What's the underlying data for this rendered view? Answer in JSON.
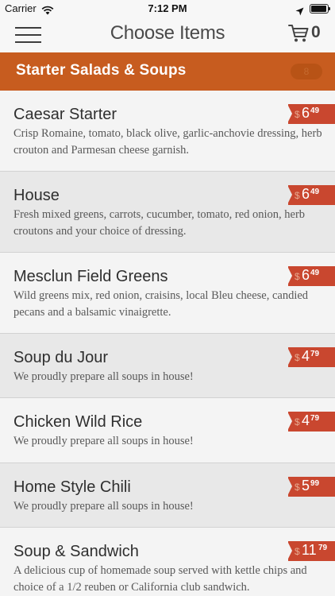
{
  "status_bar": {
    "carrier": "Carrier",
    "time": "7:12 PM",
    "battery_level": 0.95
  },
  "nav": {
    "title": "Choose Items",
    "cart_count": "0"
  },
  "category": {
    "name": "Starter Salads & Soups",
    "count": "8"
  },
  "items": [
    {
      "name": "Caesar Starter",
      "description": "Crisp Romaine, tomato, black olive, garlic-anchovie dressing, herb crouton and Parmesan cheese garnish.",
      "currency": "$",
      "price_dollars": "6",
      "price_cents": "49"
    },
    {
      "name": "House",
      "description": "Fresh mixed greens, carrots, cucumber, tomato, red onion, herb croutons and your choice of dressing.",
      "currency": "$",
      "price_dollars": "6",
      "price_cents": "49"
    },
    {
      "name": "Mesclun Field Greens",
      "description": "Wild greens mix, red onion, craisins, local Bleu cheese, candied pecans and a balsamic vinaigrette.",
      "currency": "$",
      "price_dollars": "6",
      "price_cents": "49"
    },
    {
      "name": "Soup du Jour",
      "description": "We proudly prepare all soups in house!",
      "currency": "$",
      "price_dollars": "4",
      "price_cents": "79"
    },
    {
      "name": "Chicken Wild Rice",
      "description": "We proudly prepare all soups in house!",
      "currency": "$",
      "price_dollars": "4",
      "price_cents": "79"
    },
    {
      "name": "Home Style Chili",
      "description": "We proudly prepare all soups in house!",
      "currency": "$",
      "price_dollars": "5",
      "price_cents": "99"
    },
    {
      "name": "Soup & Sandwich",
      "description": "A delicious cup of homemade soup served with kettle chips and choice of a 1/2 reuben or California club sandwich.",
      "currency": "$",
      "price_dollars": "11",
      "price_cents": "79"
    }
  ]
}
